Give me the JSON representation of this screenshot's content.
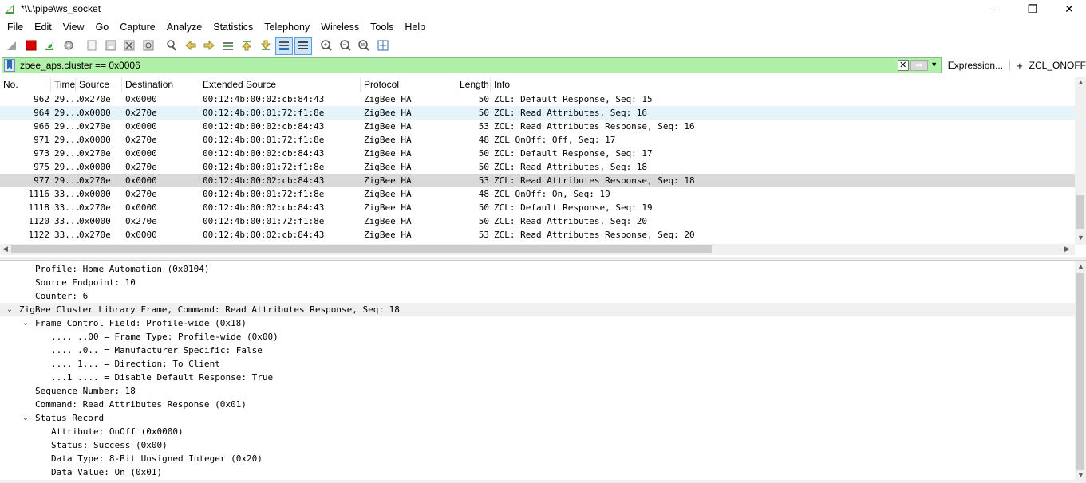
{
  "window": {
    "title": "*\\\\.\\pipe\\ws_socket",
    "minimize": "—",
    "maximize": "❐",
    "close": "✕"
  },
  "menu": [
    "File",
    "Edit",
    "View",
    "Go",
    "Capture",
    "Analyze",
    "Statistics",
    "Telephony",
    "Wireless",
    "Tools",
    "Help"
  ],
  "filter": {
    "value": "zbee_aps.cluster == 0x0006",
    "expression_label": "Expression...",
    "plus_label": "+",
    "button_label": "ZCL_ONOFF",
    "bg_color": "#b1f0a8"
  },
  "packet_list": {
    "columns": [
      "No.",
      "Time",
      "Source",
      "Destination",
      "Extended Source",
      "Protocol",
      "Length",
      "Info"
    ],
    "rows": [
      {
        "no": "962",
        "time": "29...",
        "src": "0x270e",
        "dst": "0x0000",
        "ext": "00:12:4b:00:02:cb:84:43",
        "proto": "ZigBee HA",
        "len": "50",
        "info": "ZCL: Default Response, Seq: 15"
      },
      {
        "no": "964",
        "time": "29...",
        "src": "0x0000",
        "dst": "0x270e",
        "ext": "00:12:4b:00:01:72:f1:8e",
        "proto": "ZigBee HA",
        "len": "50",
        "info": "ZCL: Read Attributes, Seq: 16"
      },
      {
        "no": "966",
        "time": "29...",
        "src": "0x270e",
        "dst": "0x0000",
        "ext": "00:12:4b:00:02:cb:84:43",
        "proto": "ZigBee HA",
        "len": "53",
        "info": "ZCL: Read Attributes Response, Seq: 16"
      },
      {
        "no": "971",
        "time": "29...",
        "src": "0x0000",
        "dst": "0x270e",
        "ext": "00:12:4b:00:01:72:f1:8e",
        "proto": "ZigBee HA",
        "len": "48",
        "info": "ZCL OnOff: Off, Seq: 17"
      },
      {
        "no": "973",
        "time": "29...",
        "src": "0x270e",
        "dst": "0x0000",
        "ext": "00:12:4b:00:02:cb:84:43",
        "proto": "ZigBee HA",
        "len": "50",
        "info": "ZCL: Default Response, Seq: 17"
      },
      {
        "no": "975",
        "time": "29...",
        "src": "0x0000",
        "dst": "0x270e",
        "ext": "00:12:4b:00:01:72:f1:8e",
        "proto": "ZigBee HA",
        "len": "50",
        "info": "ZCL: Read Attributes, Seq: 18"
      },
      {
        "no": "977",
        "time": "29...",
        "src": "0x270e",
        "dst": "0x0000",
        "ext": "00:12:4b:00:02:cb:84:43",
        "proto": "ZigBee HA",
        "len": "53",
        "info": "ZCL: Read Attributes Response, Seq: 18"
      },
      {
        "no": "1116",
        "time": "33...",
        "src": "0x0000",
        "dst": "0x270e",
        "ext": "00:12:4b:00:01:72:f1:8e",
        "proto": "ZigBee HA",
        "len": "48",
        "info": "ZCL OnOff: On, Seq: 19"
      },
      {
        "no": "1118",
        "time": "33...",
        "src": "0x270e",
        "dst": "0x0000",
        "ext": "00:12:4b:00:02:cb:84:43",
        "proto": "ZigBee HA",
        "len": "50",
        "info": "ZCL: Default Response, Seq: 19"
      },
      {
        "no": "1120",
        "time": "33...",
        "src": "0x0000",
        "dst": "0x270e",
        "ext": "00:12:4b:00:01:72:f1:8e",
        "proto": "ZigBee HA",
        "len": "50",
        "info": "ZCL: Read Attributes, Seq: 20"
      },
      {
        "no": "1122",
        "time": "33...",
        "src": "0x270e",
        "dst": "0x0000",
        "ext": "00:12:4b:00:02:cb:84:43",
        "proto": "ZigBee HA",
        "len": "53",
        "info": "ZCL: Read Attributes Response, Seq: 20"
      }
    ],
    "hover_row_no": "964",
    "selected_row_no": "977"
  },
  "details": [
    {
      "text": "Profile: Home Automation (0x0104)",
      "level": 2,
      "chevron": ""
    },
    {
      "text": "Source Endpoint: 10",
      "level": 2,
      "chevron": ""
    },
    {
      "text": "Counter: 6",
      "level": 2,
      "chevron": ""
    },
    {
      "text": "ZigBee Cluster Library Frame, Command: Read Attributes Response, Seq: 18",
      "level": 1,
      "chevron": "down",
      "highlight": true
    },
    {
      "text": "Frame Control Field: Profile-wide (0x18)",
      "level": 2,
      "chevron": "down"
    },
    {
      "text": ".... ..00 = Frame Type: Profile-wide (0x00)",
      "level": 3,
      "chevron": ""
    },
    {
      "text": ".... .0.. = Manufacturer Specific: False",
      "level": 3,
      "chevron": ""
    },
    {
      "text": ".... 1... = Direction: To Client",
      "level": 3,
      "chevron": ""
    },
    {
      "text": "...1 .... = Disable Default Response: True",
      "level": 3,
      "chevron": ""
    },
    {
      "text": "Sequence Number: 18",
      "level": 2,
      "chevron": ""
    },
    {
      "text": "Command: Read Attributes Response (0x01)",
      "level": 2,
      "chevron": ""
    },
    {
      "text": "Status Record",
      "level": 2,
      "chevron": "down"
    },
    {
      "text": "Attribute: OnOff (0x0000)",
      "level": 3,
      "chevron": ""
    },
    {
      "text": "Status: Success (0x00)",
      "level": 3,
      "chevron": ""
    },
    {
      "text": "Data Type: 8-Bit Unsigned Integer (0x20)",
      "level": 3,
      "chevron": ""
    },
    {
      "text": "Data Value: On (0x01)",
      "level": 3,
      "chevron": ""
    }
  ],
  "toolbar_icons": [
    "shark-fin-icon",
    "stop-capture-icon",
    "restart-capture-icon",
    "capture-options-icon",
    "open-file-icon",
    "save-file-icon",
    "close-file-icon",
    "reload-file-icon",
    "find-packet-icon",
    "go-back-icon",
    "go-forward-icon",
    "go-to-packet-icon",
    "go-first-icon",
    "go-last-icon",
    "autoscroll-icon",
    "colorize-icon",
    "zoom-in-icon",
    "zoom-out-icon",
    "zoom-normal-icon",
    "resize-columns-icon"
  ]
}
